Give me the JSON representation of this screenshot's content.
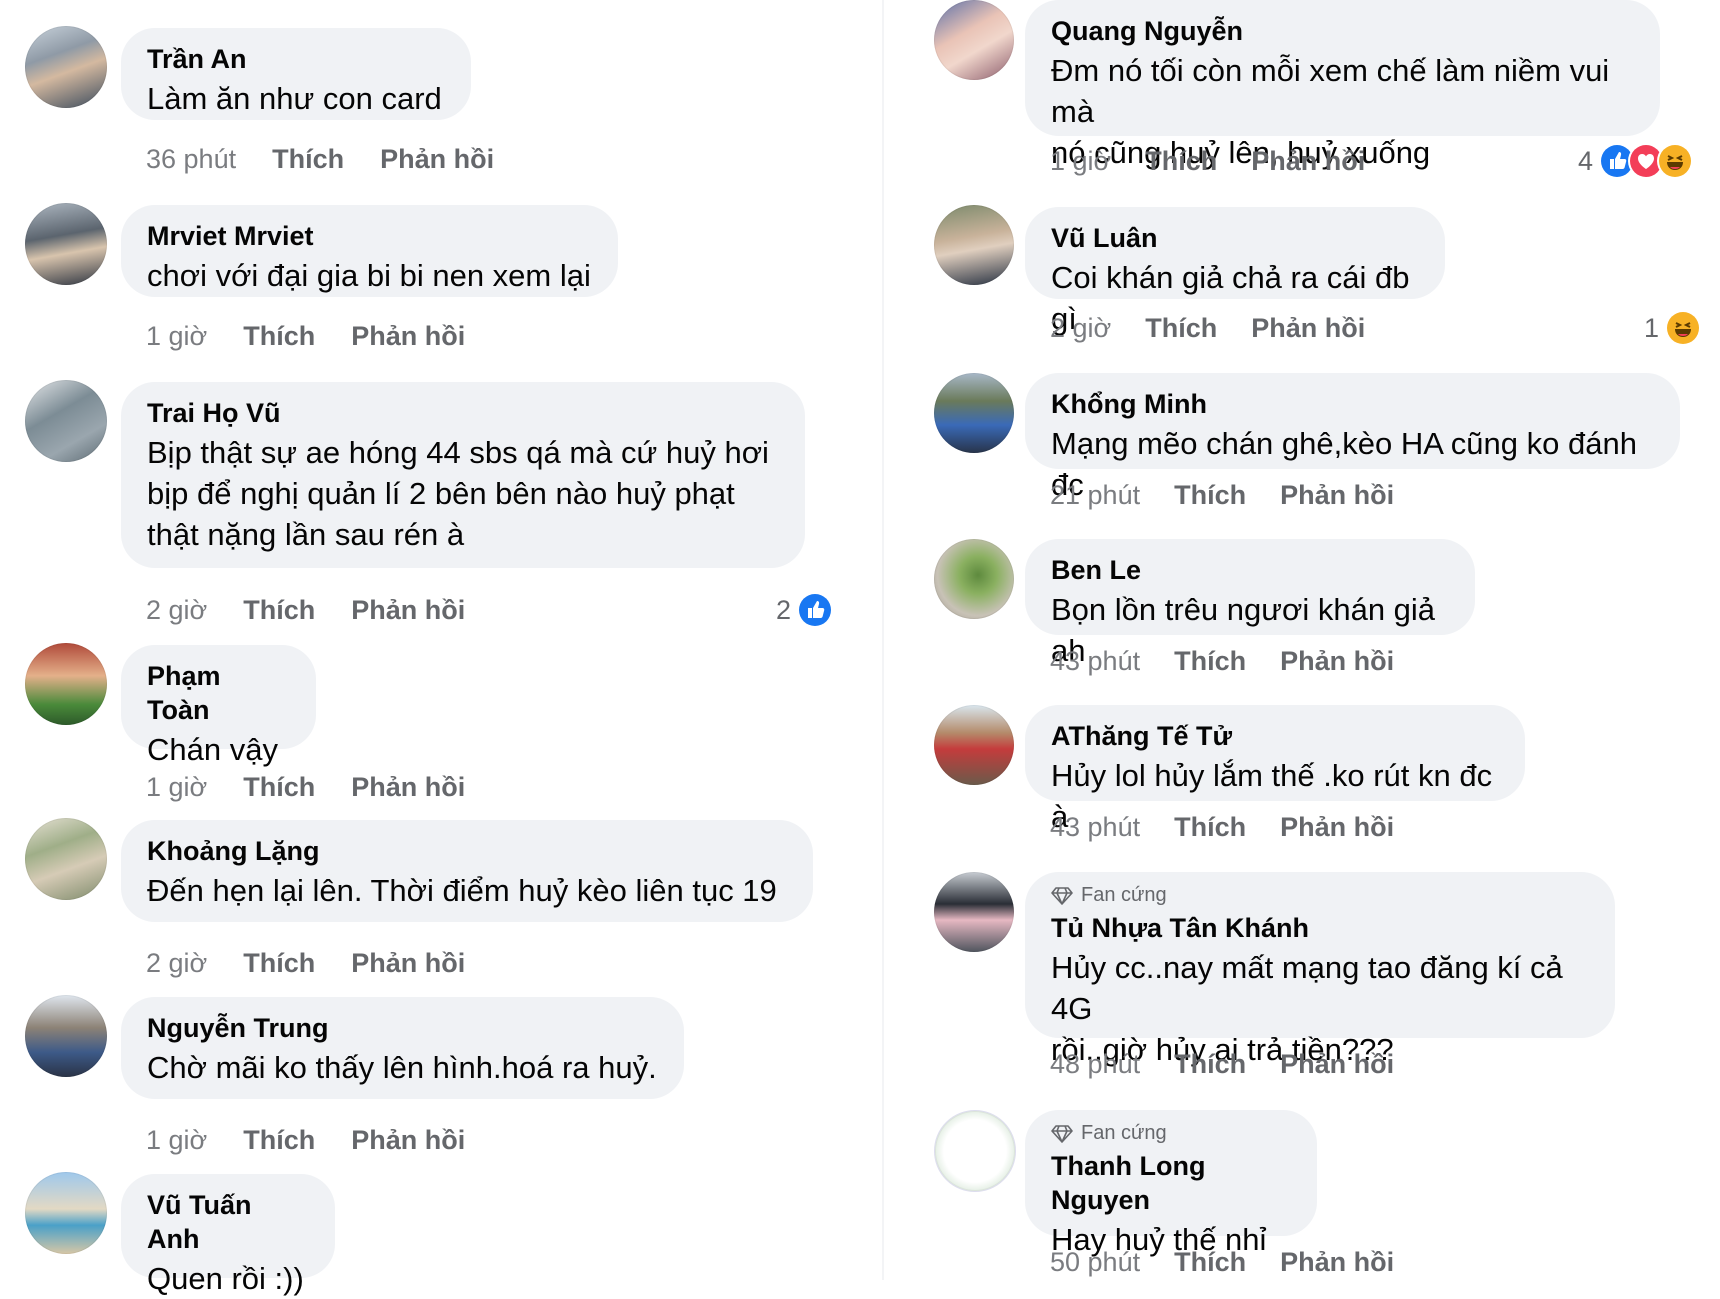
{
  "labels": {
    "like": "Thích",
    "reply": "Phản hồi",
    "fan_badge": "Fan cứng"
  },
  "left": [
    {
      "name": "Trần An",
      "text": "Làm ăn như con card",
      "time": "36 phút"
    },
    {
      "name": "Mrviet Mrviet",
      "text": "chơi với đại gia bi bi nen xem lại",
      "time": "1 giờ"
    },
    {
      "name": "Trai Họ Vũ",
      "text": "Bịp thật sự ae hóng 44 sbs qá mà cứ huỷ hơi\nbịp để nghị quản lí 2 bên bên nào huỷ phạt\nthật nặng lần sau rén à",
      "time": "2 giờ",
      "reaction_count": "2"
    },
    {
      "name": "Phạm Toàn",
      "text": "Chán vậy",
      "time": "1 giờ"
    },
    {
      "name": "Khoảng Lặng",
      "text": "Đến hẹn lại lên. Thời điểm huỷ kèo liên tục 19",
      "time": "2 giờ"
    },
    {
      "name": "Nguyễn Trung",
      "text": "Chờ mãi ko thấy lên hình.hoá ra huỷ.",
      "time": "1 giờ"
    },
    {
      "name": "Vũ Tuấn Anh",
      "text": "Quen rồi :))"
    }
  ],
  "right": [
    {
      "name": "Quang Nguyễn",
      "text": "Đm nó tối còn mỗi xem chế làm niềm vui mà\nnó cũng huỷ lên, huỷ xuống",
      "time": "1 giờ",
      "reaction_count": "4"
    },
    {
      "name": "Vũ Luân",
      "text": "Coi khán giả chả ra cái đb gì",
      "time": "2 giờ",
      "reaction_count": "1"
    },
    {
      "name": "Khổng Minh",
      "text": "Mạng mẽo chán ghê,kèo HA cũng ko đánh đc",
      "time": "21 phút"
    },
    {
      "name": "Ben Le",
      "text": "Bọn lồn trêu ngươi khán giả ah",
      "time": "43 phút"
    },
    {
      "name": "AThăng Tế Tử",
      "text": "Hủy lol hủy lắm thế .ko rút kn đc à",
      "time": "43 phút"
    },
    {
      "name": "Tủ Nhựa Tân Khánh",
      "text": "Hủy cc..nay mất mạng tao đăng kí cả 4G\nrồi..giờ hủy ai trả tiền???",
      "time": "48 phút",
      "badge": "Fan cứng"
    },
    {
      "name": "Thanh Long Nguyen",
      "text": "Hay huỷ thế nhỉ",
      "time": "50 phút",
      "badge": "Fan cứng"
    }
  ],
  "colors": {
    "bubble": "#f0f2f5",
    "like_blue": "#1877f2",
    "love_red": "#f33e58",
    "haha_yellow": "#f7b125",
    "meta_gray": "#65676b"
  }
}
